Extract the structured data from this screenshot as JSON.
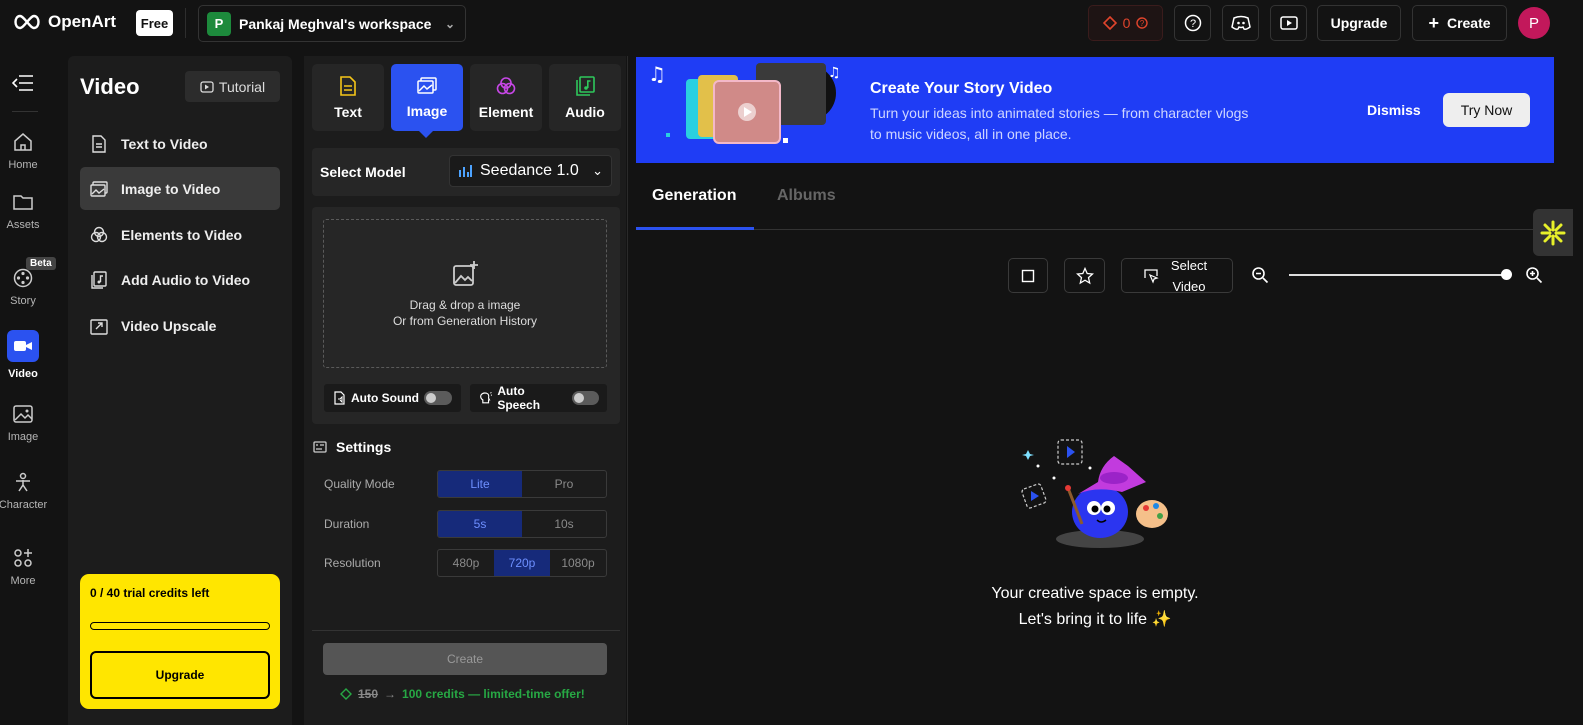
{
  "topbar": {
    "brand": "OpenArt",
    "plan_badge": "Free",
    "workspace_initial": "P",
    "workspace_name": "Pankaj Meghval's workspace",
    "credits": "0",
    "upgrade_label": "Upgrade",
    "create_label": "Create",
    "avatar_initial": "P"
  },
  "rail": {
    "items": [
      {
        "label": "Home",
        "icon": "home-icon"
      },
      {
        "label": "Assets",
        "icon": "folder-icon"
      },
      {
        "label": "Story",
        "icon": "story-icon"
      },
      {
        "label": "Video",
        "icon": "video-icon"
      },
      {
        "label": "Image",
        "icon": "image-icon"
      },
      {
        "label": "Character",
        "icon": "character-icon"
      },
      {
        "label": "More",
        "icon": "more-icon"
      }
    ],
    "beta_badge": "Beta",
    "active": "Video"
  },
  "menu": {
    "title": "Video",
    "tutorial_label": "Tutorial",
    "items": [
      {
        "label": "Text to Video"
      },
      {
        "label": "Image to Video"
      },
      {
        "label": "Elements to Video"
      },
      {
        "label": "Add Audio to Video"
      },
      {
        "label": "Video Upscale"
      }
    ],
    "trial": {
      "text": "0 / 40 trial credits left",
      "progress": 0,
      "upgrade_label": "Upgrade"
    }
  },
  "center": {
    "tabs": [
      {
        "label": "Text"
      },
      {
        "label": "Image"
      },
      {
        "label": "Element"
      },
      {
        "label": "Audio"
      }
    ],
    "select_model_label": "Select Model",
    "model_value": "Seedance 1.0",
    "drop_line1": "Drag & drop a image",
    "drop_line2": "Or from Generation History",
    "auto_sound": "Auto Sound",
    "auto_speech": "Auto Speech",
    "settings_title": "Settings",
    "quality_label": "Quality Mode",
    "quality_options": [
      "Lite",
      "Pro"
    ],
    "duration_label": "Duration",
    "duration_options": [
      "5s",
      "10s"
    ],
    "resolution_label": "Resolution",
    "resolution_options": [
      "480p",
      "720p",
      "1080p"
    ],
    "create_label": "Create",
    "old_price": "150",
    "offer_text": "100 credits — limited-time offer!"
  },
  "banner": {
    "title": "Create Your Story Video",
    "subtitle": "Turn your ideas into animated stories — from character vlogs to music videos, all in one place.",
    "dismiss_label": "Dismiss",
    "try_label": "Try Now"
  },
  "gallery": {
    "tab_generation": "Generation",
    "tab_albums": "Albums",
    "select_video_label": "Select Video",
    "zoom_level": 1.0,
    "empty_line1": "Your creative space is empty.",
    "empty_line2": "Let's bring it to life ✨"
  },
  "colors": {
    "accent": "#2b52f0",
    "trial_bg": "#ffe600",
    "banner_bg": "#1f3df5",
    "credits_red": "#e0442c",
    "offer_green": "#27a844"
  }
}
